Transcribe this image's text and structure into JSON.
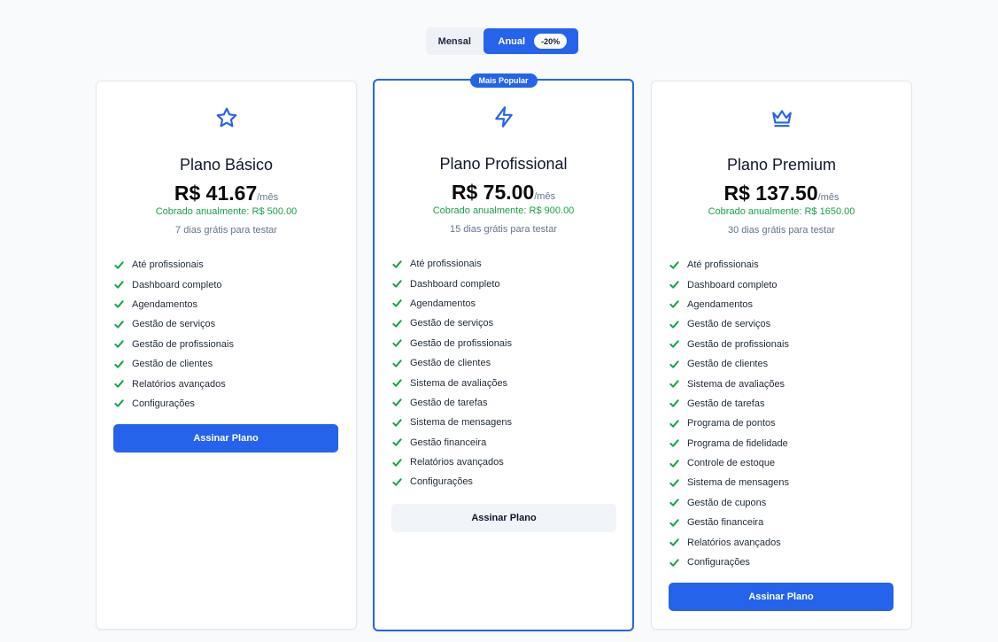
{
  "billing_toggle": {
    "monthly_label": "Mensal",
    "annual_label": "Anual",
    "annual_discount": "-20%",
    "selected": "annual"
  },
  "colors": {
    "accent": "#2563eb",
    "success": "#16a34a",
    "muted": "#64748b"
  },
  "plans": [
    {
      "icon": "star-icon",
      "name": "Plano Básico",
      "price": "R$ 41.67",
      "period": "/mês",
      "billed": "Cobrado anualmente: R$ 500.00",
      "trial": "7 dias grátis para testar",
      "features": [
        "Até profissionais",
        "Dashboard completo",
        "Agendamentos",
        "Gestão de serviços",
        "Gestão de profissionais",
        "Gestão de clientes",
        "Relatórios avançados",
        "Configurações"
      ],
      "button": "Assinar Plano"
    },
    {
      "icon": "zap-icon",
      "badge": "Mais Popular",
      "name": "Plano Profissional",
      "price": "R$ 75.00",
      "period": "/mês",
      "billed": "Cobrado anualmente: R$ 900.00",
      "trial": "15 dias grátis para testar",
      "features": [
        "Até profissionais",
        "Dashboard completo",
        "Agendamentos",
        "Gestão de serviços",
        "Gestão de profissionais",
        "Gestão de clientes",
        "Sistema de avaliações",
        "Gestão de tarefas",
        "Sistema de mensagens",
        "Gestão financeira",
        "Relatórios avançados",
        "Configurações"
      ],
      "button": "Assinar Plano"
    },
    {
      "icon": "crown-icon",
      "name": "Plano Premium",
      "price": "R$ 137.50",
      "period": "/mês",
      "billed": "Cobrado anualmente: R$ 1650.00",
      "trial": "30 dias grátis para testar",
      "features": [
        "Até profissionais",
        "Dashboard completo",
        "Agendamentos",
        "Gestão de serviços",
        "Gestão de profissionais",
        "Gestão de clientes",
        "Sistema de avaliações",
        "Gestão de tarefas",
        "Programa de pontos",
        "Programa de fidelidade",
        "Controle de estoque",
        "Sistema de mensagens",
        "Gestão de cupons",
        "Gestão financeira",
        "Relatórios avançados",
        "Configurações"
      ],
      "button": "Assinar Plano"
    }
  ]
}
